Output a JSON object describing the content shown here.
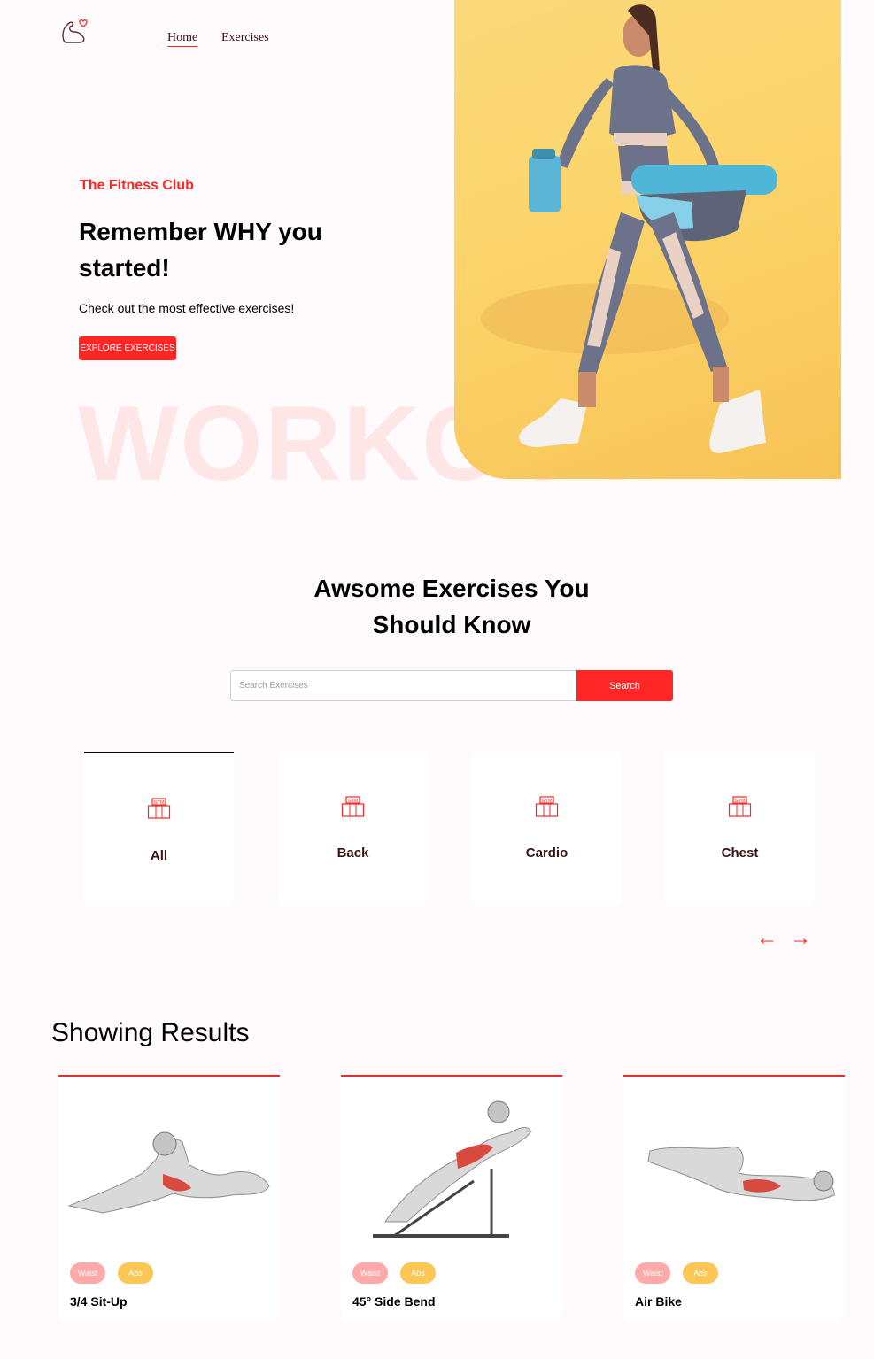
{
  "nav": {
    "home_label": "Home",
    "exercises_label": "Exercises",
    "logo_icon": "flexed-arm-heart-icon"
  },
  "hero": {
    "eyebrow": "The Fitness Club",
    "title": "Remember WHY you started!",
    "subtitle": "Check out the most effective exercises!",
    "button_label": "EXPLORE EXERCISES",
    "watermark": "WORKOUT",
    "image": "woman-walking-with-gym-bag-photo"
  },
  "exercises_section": {
    "heading": "Awsome Exercises You Should Know",
    "search_placeholder": "Search Exercises",
    "search_button": "Search"
  },
  "categories": [
    {
      "label": "All",
      "icon": "gym-icon",
      "active": true
    },
    {
      "label": "Back",
      "icon": "gym-icon"
    },
    {
      "label": "Cardio",
      "icon": "gym-icon"
    },
    {
      "label": "Chest",
      "icon": "gym-icon"
    }
  ],
  "pager": {
    "prev_icon": "left-arrow-icon",
    "next_icon": "right-arrow-icon",
    "prev": "←",
    "next": "→"
  },
  "results": {
    "title": "Showing Results",
    "cards": [
      {
        "name": "3/4 Sit-Up",
        "tags": [
          "Waist",
          "Abs"
        ]
      },
      {
        "name": "45° Side Bend",
        "tags": [
          "Waist",
          "Abs"
        ]
      },
      {
        "name": "Air Bike",
        "tags": [
          "Waist",
          "Abs"
        ]
      }
    ]
  },
  "colors": {
    "accent": "#ff2625",
    "tag_waist": "#ffa9a9",
    "tag_abs": "#fcc757",
    "background": "#fffafb"
  }
}
